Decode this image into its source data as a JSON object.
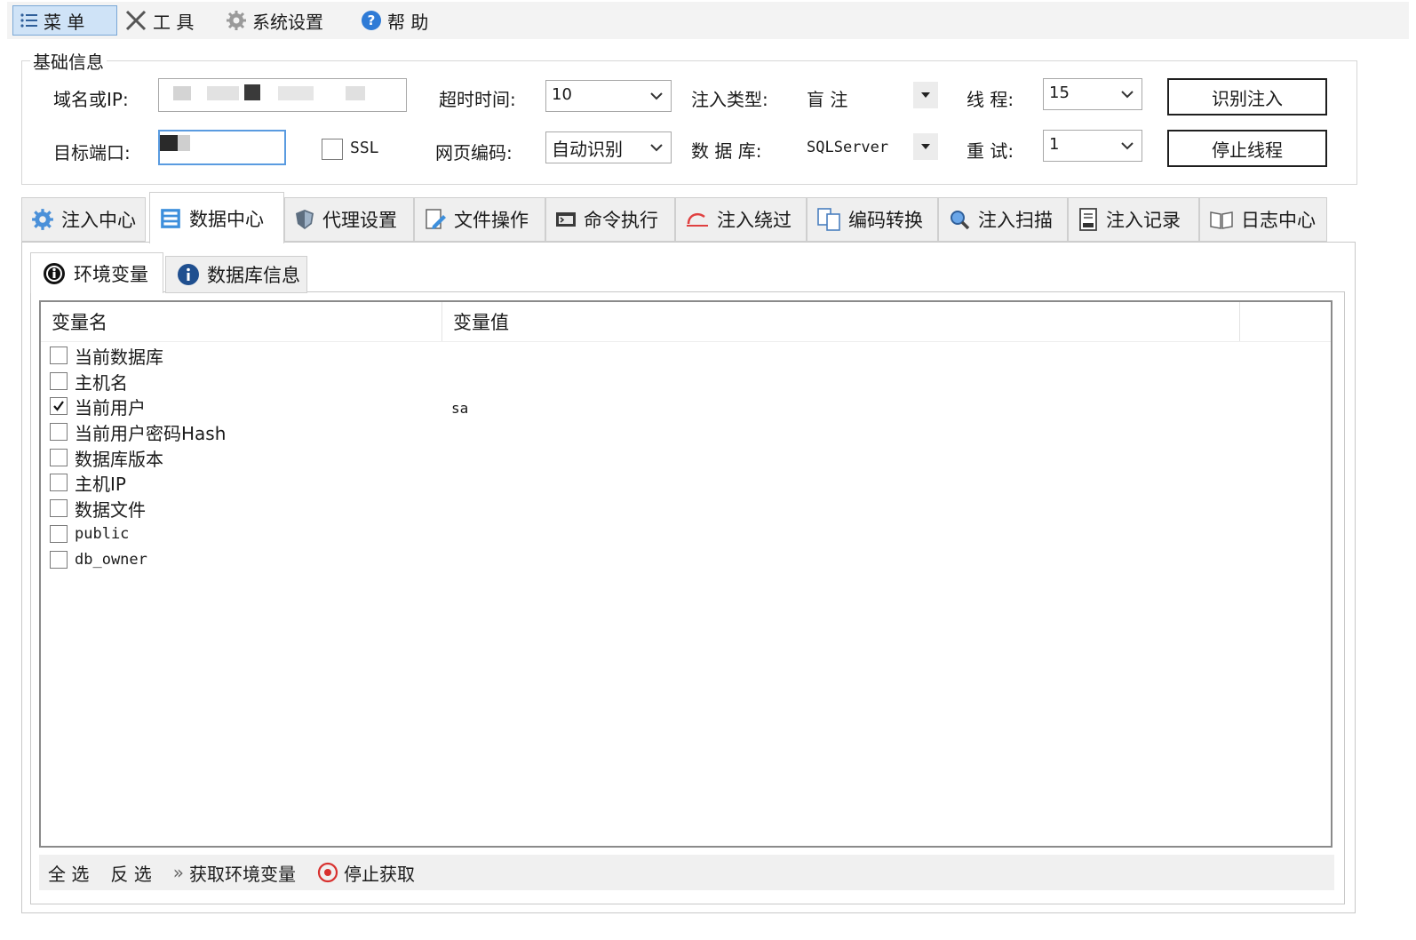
{
  "menu": {
    "items": [
      {
        "label": "菜 单",
        "icon": "list-icon"
      },
      {
        "label": "工 具",
        "icon": "tools-icon"
      },
      {
        "label": "系统设置",
        "icon": "gear-icon"
      },
      {
        "label": "帮 助",
        "icon": "help-icon"
      }
    ]
  },
  "basic": {
    "title": "基础信息",
    "domain_label": "域名或IP:",
    "domain_value": "",
    "timeout_label": "超时时间:",
    "timeout_value": "10",
    "inject_type_label": "注入类型:",
    "inject_type_value": "盲 注",
    "threads_label": "线 程:",
    "threads_value": "15",
    "identify_button": "识别注入",
    "port_label": "目标端口:",
    "port_value": "",
    "ssl_label": "SSL",
    "ssl_checked": false,
    "encoding_label": "网页编码:",
    "encoding_value": "自动识别",
    "db_label": "数 据 库:",
    "db_value": "SQLServer",
    "retry_label": "重 试:",
    "retry_value": "1",
    "stop_button": "停止线程"
  },
  "tabs": [
    {
      "label": "注入中心",
      "icon": "gear-icon",
      "active": false
    },
    {
      "label": "数据中心",
      "icon": "database-icon",
      "active": true
    },
    {
      "label": "代理设置",
      "icon": "shield-icon",
      "active": false
    },
    {
      "label": "文件操作",
      "icon": "file-edit-icon",
      "active": false
    },
    {
      "label": "命令执行",
      "icon": "terminal-icon",
      "active": false
    },
    {
      "label": "注入绕过",
      "icon": "bypass-icon",
      "active": false
    },
    {
      "label": "编码转换",
      "icon": "convert-icon",
      "active": false
    },
    {
      "label": "注入扫描",
      "icon": "scan-icon",
      "active": false
    },
    {
      "label": "注入记录",
      "icon": "record-icon",
      "active": false
    },
    {
      "label": "日志中心",
      "icon": "log-icon",
      "active": false
    }
  ],
  "subtabs": [
    {
      "label": "环境变量",
      "icon": "info-dark-icon",
      "active": true
    },
    {
      "label": "数据库信息",
      "icon": "info-blue-icon",
      "active": false
    }
  ],
  "table": {
    "col_name": "变量名",
    "col_value": "变量值",
    "rows": [
      {
        "name": "当前数据库",
        "checked": false,
        "value": ""
      },
      {
        "name": "主机名",
        "checked": false,
        "value": ""
      },
      {
        "name": "当前用户",
        "checked": true,
        "value": "sa"
      },
      {
        "name": "当前用户密码Hash",
        "checked": false,
        "value": ""
      },
      {
        "name": "数据库版本",
        "checked": false,
        "value": ""
      },
      {
        "name": "主机IP",
        "checked": false,
        "value": ""
      },
      {
        "name": "数据文件",
        "checked": false,
        "value": ""
      },
      {
        "name": "public",
        "checked": false,
        "value": ""
      },
      {
        "name": "db_owner",
        "checked": false,
        "value": ""
      }
    ]
  },
  "bottom": {
    "select_all": "全 选",
    "invert": "反 选",
    "fetch": "获取环境变量",
    "stop_fetch": "停止获取"
  },
  "colors": {
    "accent": "#2f7bd6",
    "stop": "#d8312f"
  }
}
